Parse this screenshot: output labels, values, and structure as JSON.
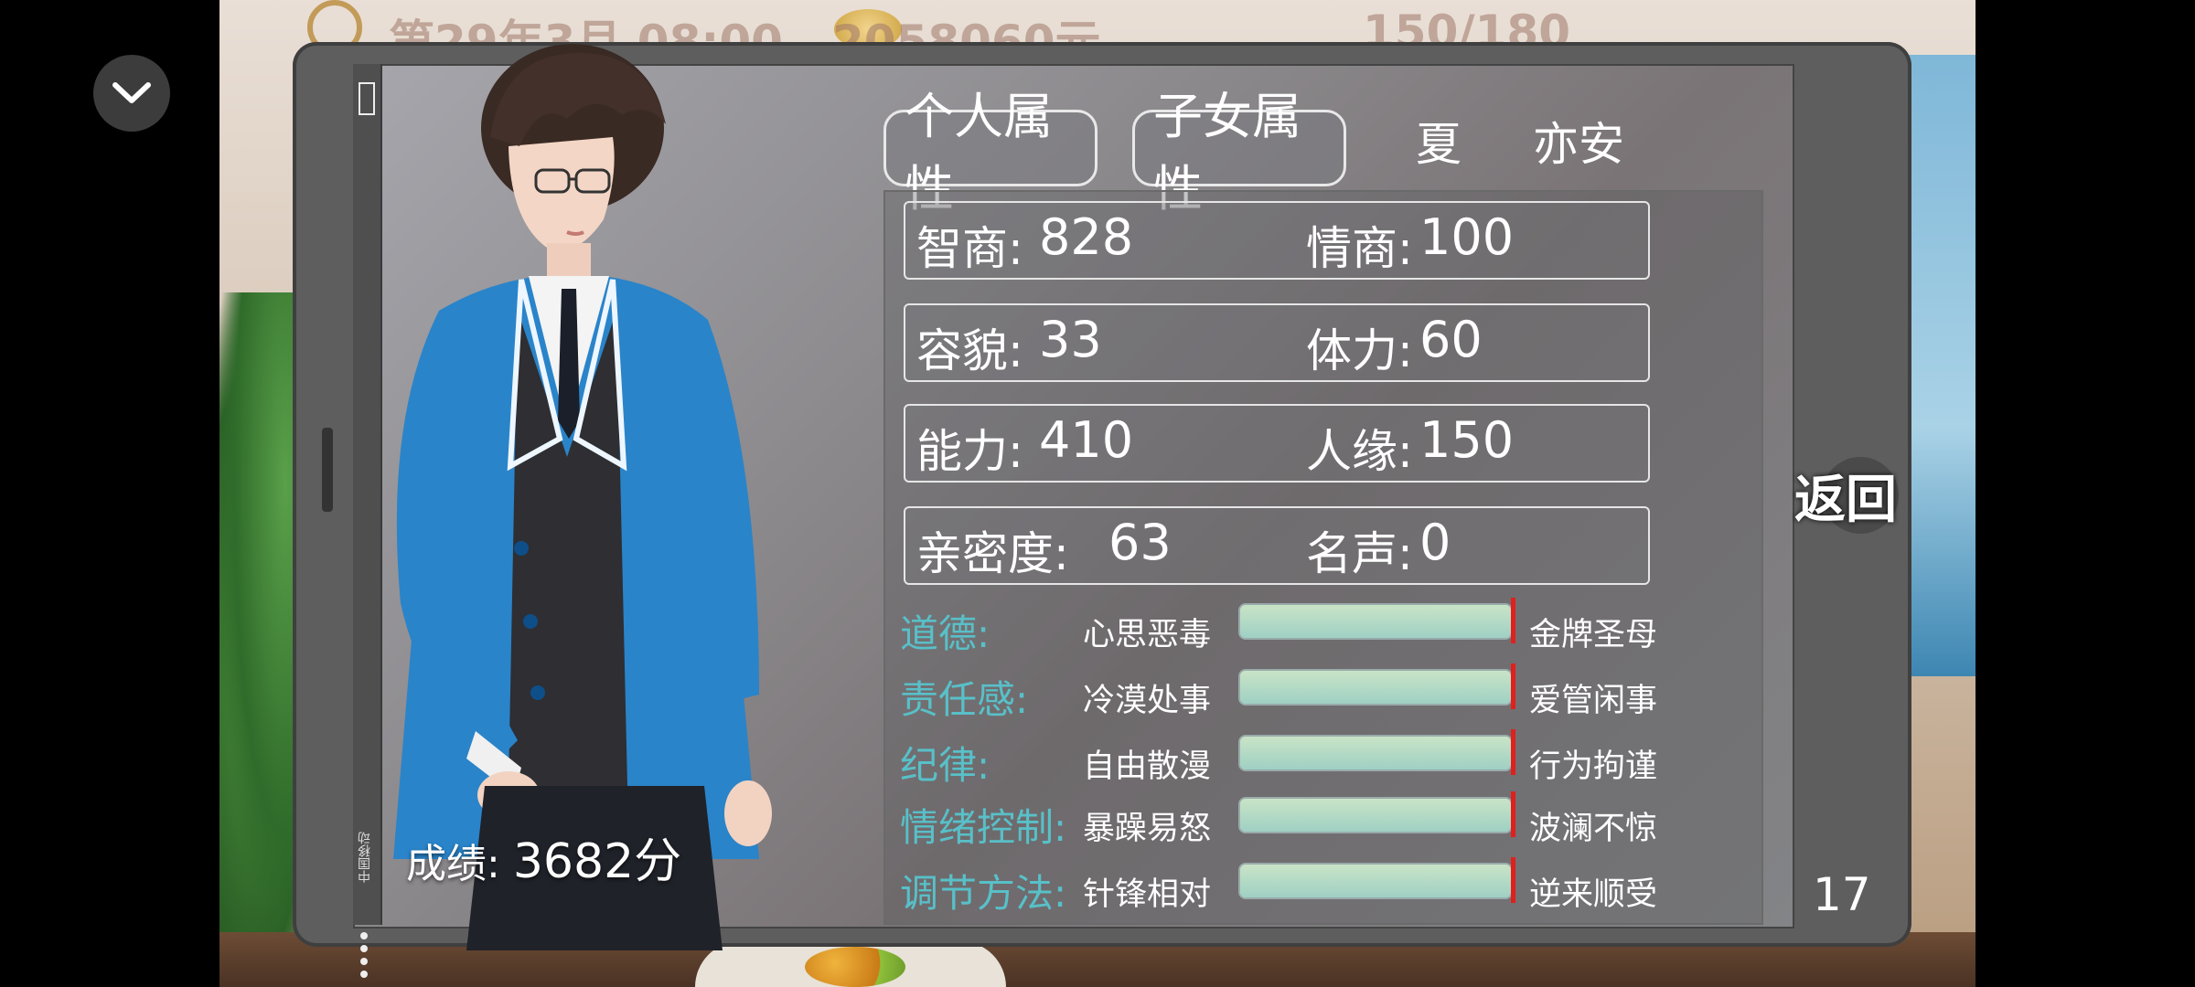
{
  "hud": {
    "date_time": "第29年3月  08:00",
    "money": "2058060元",
    "energy": "150/180"
  },
  "character": {
    "score_label": "成绩:",
    "score_value": "3682分"
  },
  "device": {
    "carrier": "中国移动"
  },
  "tabs": [
    {
      "label": "个人属性",
      "active": true
    },
    {
      "label": "子女属性",
      "active": false
    }
  ],
  "name": {
    "surname": "夏",
    "given": "亦安"
  },
  "stats": [
    {
      "k1": "智商:",
      "v1": "828",
      "k2": "情商:",
      "v2": "100"
    },
    {
      "k1": "容貌:",
      "v1": "33",
      "k2": "体力:",
      "v2": "60"
    },
    {
      "k1": "能力:",
      "v1": "410",
      "k2": "人缘:",
      "v2": "150"
    },
    {
      "k1": "亲密度:",
      "v1": "63",
      "k2": "名声:",
      "v2": "0"
    }
  ],
  "traits": [
    {
      "name": "道德:",
      "low": "心思恶毒",
      "high": "金牌圣母",
      "level": 1.0
    },
    {
      "name": "责任感:",
      "low": "冷漠处事",
      "high": "爱管闲事",
      "level": 1.0
    },
    {
      "name": "纪律:",
      "low": "自由散漫",
      "high": "行为拘谨",
      "level": 1.0
    },
    {
      "name": "情绪控制:",
      "low": "暴躁易怒",
      "high": "波澜不惊",
      "level": 1.0
    },
    {
      "name": "调节方法:",
      "low": "针锋相对",
      "high": "逆来顺受",
      "level": 1.0
    }
  ],
  "buttons": {
    "return_label": "返回"
  },
  "page_number": "17",
  "icons": {
    "collapse": "chevron-down-icon",
    "battery": "battery-icon"
  }
}
